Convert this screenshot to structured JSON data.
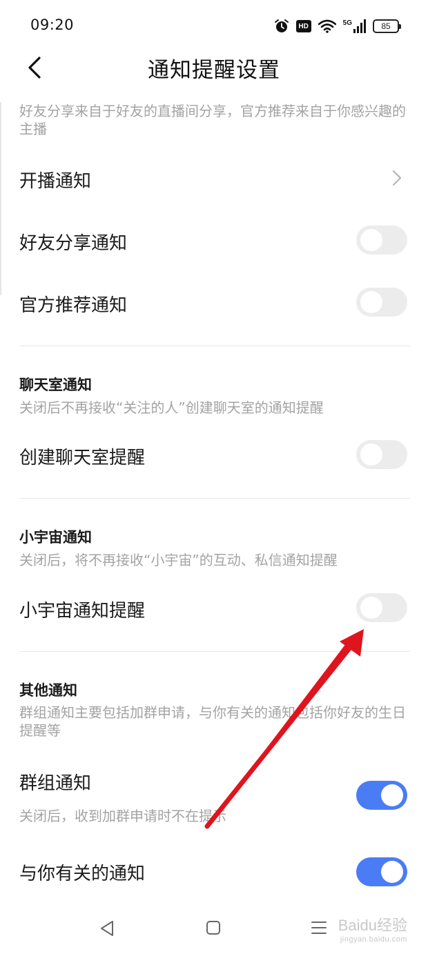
{
  "status_bar": {
    "time": "09:20",
    "hd": "HD",
    "network": "5G",
    "battery": "85",
    "icons": [
      "alarm-icon",
      "hd-icon",
      "wifi-icon",
      "signal-icon",
      "battery-icon"
    ]
  },
  "header": {
    "title": "通知提醒设置",
    "back_icon": "chevron-left-icon"
  },
  "sections": {
    "live": {
      "desc": "好友分享来自于好友的直播间分享，官方推荐来自于你感兴趣的主播",
      "rows": [
        {
          "label": "开播通知",
          "control": "chevron"
        },
        {
          "label": "好友分享通知",
          "control": "toggle",
          "on": false
        },
        {
          "label": "官方推荐通知",
          "control": "toggle",
          "on": false
        }
      ]
    },
    "chatroom": {
      "title": "聊天室通知",
      "desc": "关闭后不再接收“关注的人”创建聊天室的通知提醒",
      "rows": [
        {
          "label": "创建聊天室提醒",
          "control": "toggle",
          "on": false
        }
      ]
    },
    "universe": {
      "title": "小宇宙通知",
      "desc": "关闭后，将不再接收“小宇宙”的互动、私信通知提醒",
      "rows": [
        {
          "label": "小宇宙通知提醒",
          "control": "toggle",
          "on": false
        }
      ]
    },
    "other": {
      "title": "其他通知",
      "desc": "群组通知主要包括加群申请，与你有关的通知包括你好友的生日提醒等",
      "rows": [
        {
          "label": "群组通知",
          "sub": "关闭后，收到加群申请时不在提示",
          "control": "toggle",
          "on": true
        },
        {
          "label": "与你有关的通知",
          "control": "toggle",
          "on": true
        }
      ]
    }
  },
  "system_nav": {
    "buttons": [
      "back-triangle-icon",
      "home-square-icon",
      "menu-lines-icon"
    ],
    "watermark": "Baidu经验",
    "watermark_sub": "jingyan.baidu.com"
  },
  "colors": {
    "toggle_on": "#4a7cf5",
    "toggle_off": "#ececec",
    "muted_text": "#a3a3a3",
    "annotation_arrow": "#e0141e"
  }
}
